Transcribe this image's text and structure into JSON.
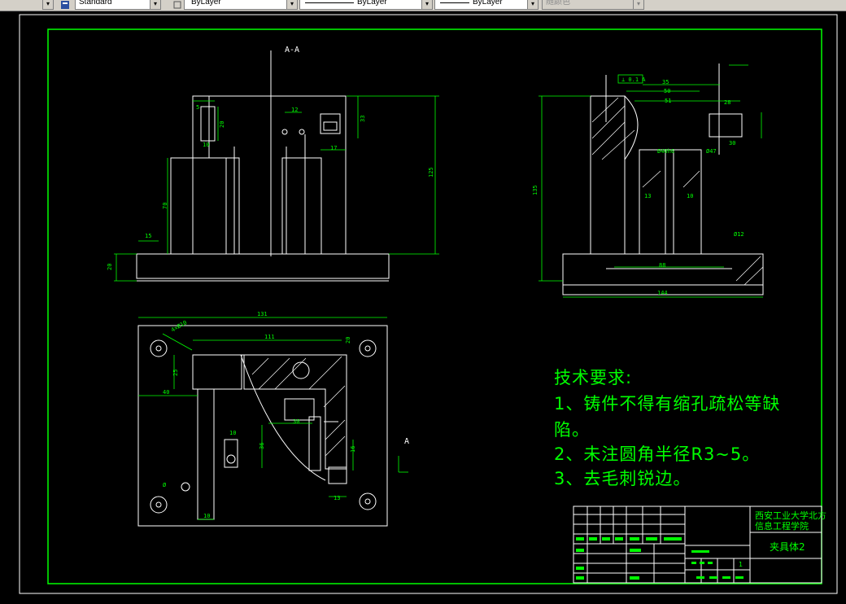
{
  "toolbar": {
    "text_style": "Standard",
    "layer": "ByLayer",
    "linetype": "ByLayer",
    "lineweight": "ByLayer",
    "plot_style": "随颜色"
  },
  "drawing": {
    "section_label": "A-A",
    "arrow_label": "A",
    "technical_requirements": {
      "heading": "技术要求:",
      "line1a": "1、铸件不得有缩孔疏松等缺",
      "line1b": "陷。",
      "line2": "2、未注圆角半径R3~5。",
      "line3": "3、去毛刺锐边。"
    },
    "title_block": {
      "school_line1": "西安工业大学北方",
      "school_line2": "信息工程学院",
      "part_name": "夹具体2",
      "sheet": "1"
    }
  },
  "colors": {
    "background": "#000000",
    "drawing_lines": "#ffffff",
    "dimensions": "#00ff00",
    "border": "#00ff00"
  }
}
